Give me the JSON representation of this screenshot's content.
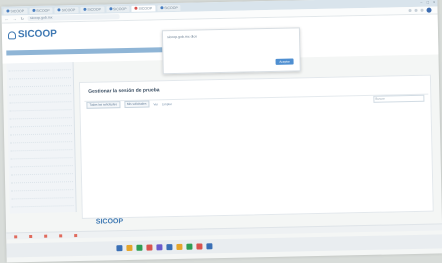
{
  "browser": {
    "tabs": [
      {
        "label": "SICOOP",
        "color": "#4a7fc1"
      },
      {
        "label": "SICOOP",
        "color": "#4a7fc1"
      },
      {
        "label": "SICOOP",
        "color": "#4a7fc1"
      },
      {
        "label": "SICOOP",
        "color": "#4a7fc1"
      },
      {
        "label": "SICOOP",
        "color": "#4a7fc1"
      },
      {
        "label": "SICOOP",
        "color": "#d9534f"
      },
      {
        "label": "SICOOP",
        "color": "#4a7fc1"
      }
    ],
    "url": "sicoop.gob.mx",
    "window_controls": [
      "−",
      "□",
      "×"
    ]
  },
  "header": {
    "logo_text": "SICOOP",
    "brand_color": "#3f79b3"
  },
  "main": {
    "title": "Gestionar la sesión de prueba",
    "filter_buttons": [
      "Todas las solicitudes",
      "Mis solicitudes"
    ],
    "filter_links": [
      "Ver",
      "Limpiar"
    ],
    "search_placeholder": "Buscar"
  },
  "popup": {
    "title": "sicoop.gob.mx dice",
    "button_label": "Aceptar"
  },
  "footer": {
    "logo_text": "SICOOP"
  },
  "taskbar": {
    "icon_colors": [
      "#3a6fb5",
      "#e5a52b",
      "#2f9e54",
      "#d9534f",
      "#6a5acd",
      "#3a6fb5",
      "#e5a52b",
      "#2f9e54",
      "#d9534f",
      "#3a6fb5"
    ]
  }
}
